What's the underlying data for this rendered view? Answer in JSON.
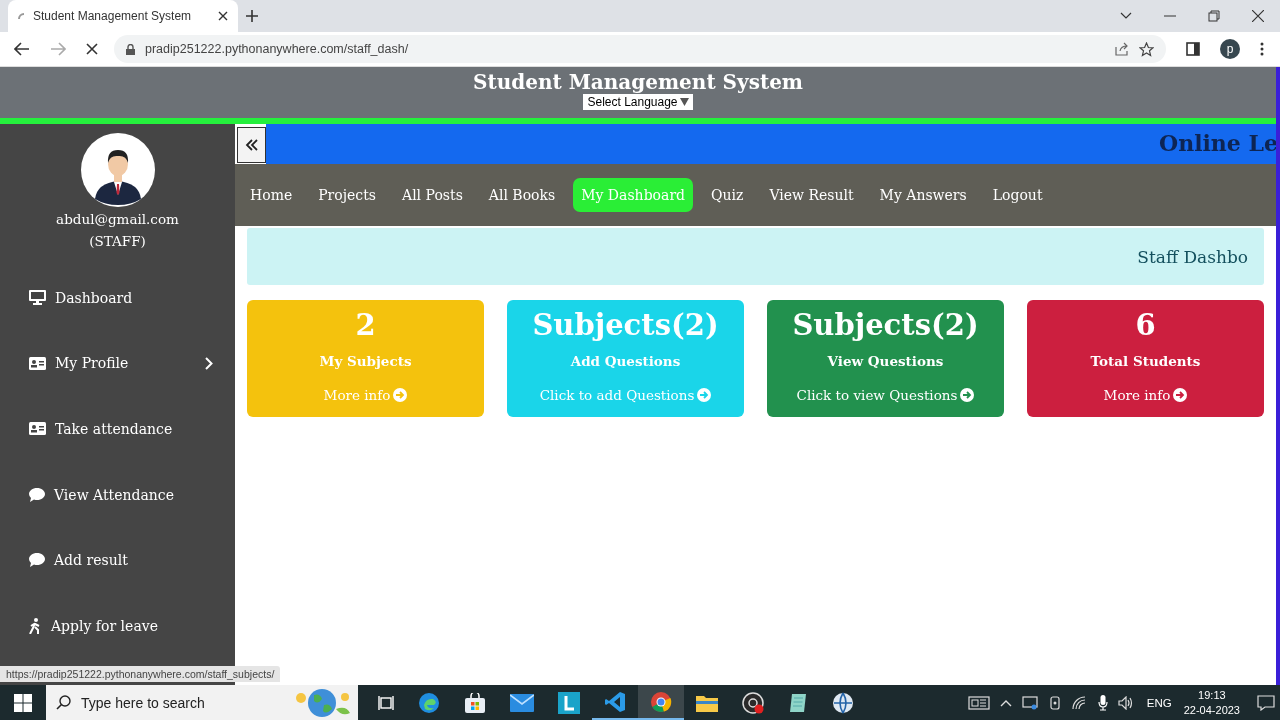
{
  "browser": {
    "tab_title": "Student Management System",
    "url": "pradip251222.pythonanywhere.com/staff_dash/",
    "profile_initial": "p"
  },
  "header": {
    "title": "Student Management System",
    "language_select": "Select Language"
  },
  "sidebar": {
    "user_email": "abdul@gmail.com",
    "role": "(STAFF)",
    "items": [
      {
        "label": "Dashboard",
        "kind": "monitor",
        "has_submenu": false
      },
      {
        "label": "My Profile",
        "kind": "card",
        "has_submenu": true
      },
      {
        "label": "Take attendance",
        "kind": "card",
        "has_submenu": false
      },
      {
        "label": "View Attendance",
        "kind": "chat",
        "has_submenu": false
      },
      {
        "label": "Add result",
        "kind": "chat",
        "has_submenu": false
      },
      {
        "label": "Apply for leave",
        "kind": "walk",
        "has_submenu": false
      }
    ]
  },
  "marquee_text": "Online Le",
  "nav": [
    {
      "label": "Home",
      "selected": false
    },
    {
      "label": "Projects",
      "selected": false
    },
    {
      "label": "All Posts",
      "selected": false
    },
    {
      "label": "All Books",
      "selected": false
    },
    {
      "label": "My Dashboard",
      "selected": true
    },
    {
      "label": "Quiz",
      "selected": false
    },
    {
      "label": "View Result",
      "selected": false
    },
    {
      "label": "My Answers",
      "selected": false
    },
    {
      "label": "Logout",
      "selected": false
    }
  ],
  "banner": "Staff Dashbo",
  "cards": [
    {
      "value": "2",
      "label": "My Subjects",
      "link": "More info",
      "color": "#f4c20d"
    },
    {
      "value": "Subjects(2)",
      "label": "Add Questions",
      "link": "Click to add Questions",
      "color": "#1ad5e9"
    },
    {
      "value": "Subjects(2)",
      "label": "View Questions",
      "link": "Click to view Questions",
      "color": "#22914e"
    },
    {
      "value": "6",
      "label": "Total Students",
      "link": "More info",
      "color": "#cc1f3f"
    }
  ],
  "status_url": "https://pradip251222.pythonanywhere.com/staff_subjects/",
  "taskbar": {
    "search_placeholder": "Type here to search",
    "language": "ENG",
    "time": "19:13",
    "date": "22-04-2023"
  }
}
